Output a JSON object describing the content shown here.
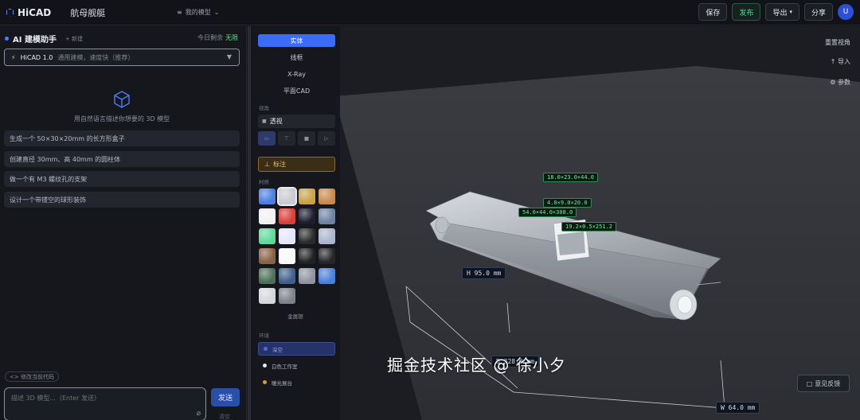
{
  "topbar": {
    "logo": "HiCAD",
    "project_name": "航母舰艇",
    "my_models": "我的模型",
    "buttons": {
      "save": "保存",
      "publish": "发布",
      "export": "导出",
      "share": "分享"
    },
    "avatar": "U"
  },
  "assistant": {
    "title": "AI 建模助手",
    "new_chat": "+ 新建",
    "quota_label": "今日剩余",
    "quota_value": "无限",
    "model_name": "HiCAD 1.0",
    "model_desc": "通用建模，速度快（推荐）",
    "hint": "用自然语言描述你想要的 3D 模型",
    "suggestions": [
      "生成一个 50×30×20mm 的长方形盒子",
      "创建直径 30mm、高 40mm 的圆柱体",
      "做一个有 M3 螺纹孔的支架",
      "设计一个带镂空的球形装饰"
    ],
    "modify_code": "<> 修改当前代码",
    "input_placeholder": "描述 3D 模型...（Enter 发送）",
    "send": "发送",
    "clear": "清空"
  },
  "tools": {
    "modes": [
      "实体",
      "线框",
      "X-Ray",
      "平面CAD"
    ],
    "active_mode": "实体",
    "view_label": "视角",
    "projection": "透视",
    "annotate": "标注",
    "material_label": "材质",
    "material_name": "金属银",
    "env_label": "环境",
    "environments": [
      "深空",
      "白色工作室",
      "暖光展台"
    ],
    "active_env": "深空"
  },
  "swatches": [
    "#4a7fe0",
    "#c9cbd0",
    "#c9a24a",
    "#c68a4e",
    "#f2f2f2",
    "#d9403a",
    "#1d1d2e",
    "#6d83a3",
    "#5fd99a",
    "#e6e6fb",
    "#2b2b2b",
    "#aab6cc",
    "#8a6244",
    "#f7f7f7",
    "#222222",
    "#262628",
    "#4d7059",
    "#3f5f8c",
    "#8f959f",
    "#4c7fd8",
    "#d5d7da",
    "#7e828a"
  ],
  "selected_swatch": 1,
  "viewport": {
    "reset_view": "重置视角",
    "import": "↑ 导入",
    "params": "⚙ 参数",
    "dimensions": {
      "d1": "18.0×23.0×44.0",
      "d2": "4.0×9.0×20.0",
      "d3": "54.0×44.0×308.0",
      "d4": "19.2×0.5×251.2",
      "height": "H 95.0 mm",
      "depth": "D 328.0 mm",
      "width": "W 64.0 mm"
    },
    "feedback": "意见反馈"
  },
  "watermark": "掘金技术社区 @ 徐小夕"
}
